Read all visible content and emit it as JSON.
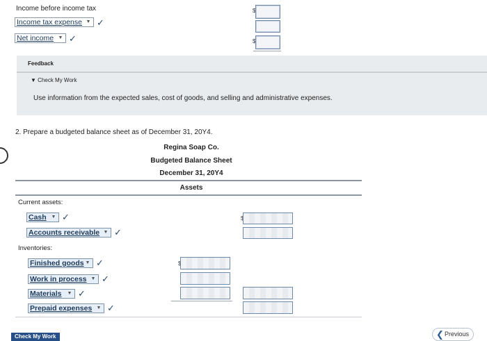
{
  "top": {
    "income_before_tax_label": "Income before income tax",
    "tax_dropdown": "Income tax expense",
    "net_income_dropdown": "Net income",
    "dollar1": "$",
    "dollar2": "$"
  },
  "feedback": {
    "label": "Feedback",
    "check_my_work": "▼ Check My Work",
    "text": "Use information from the expected sales, cost of goods, and selling and administrative expenses."
  },
  "question": {
    "text": "2.  Prepare a budgeted balance sheet as of December 31, 20Y4."
  },
  "statement": {
    "company": "Regina Soap Co.",
    "title": "Budgeted Balance Sheet",
    "date": "December 31, 20Y4",
    "section": "Assets"
  },
  "assets": {
    "current_label": "Current assets:",
    "cash": "Cash",
    "accounts_receivable": "Accounts receivable",
    "inventories_label": "Inventories:",
    "finished_goods": "Finished goods",
    "work_in_process": "Work in process",
    "materials": "Materials",
    "prepaid_expenses": "Prepaid expenses",
    "dollar_cash": "$",
    "dollar_fg": "$"
  },
  "footer": {
    "check_button": "Check My Work",
    "previous_button": "Previous"
  },
  "icons": {
    "check": "✓",
    "caret": "▼",
    "chevron": "❮"
  },
  "colors": {
    "brand": "#254f86",
    "feedback_bg": "#e9ecef"
  }
}
